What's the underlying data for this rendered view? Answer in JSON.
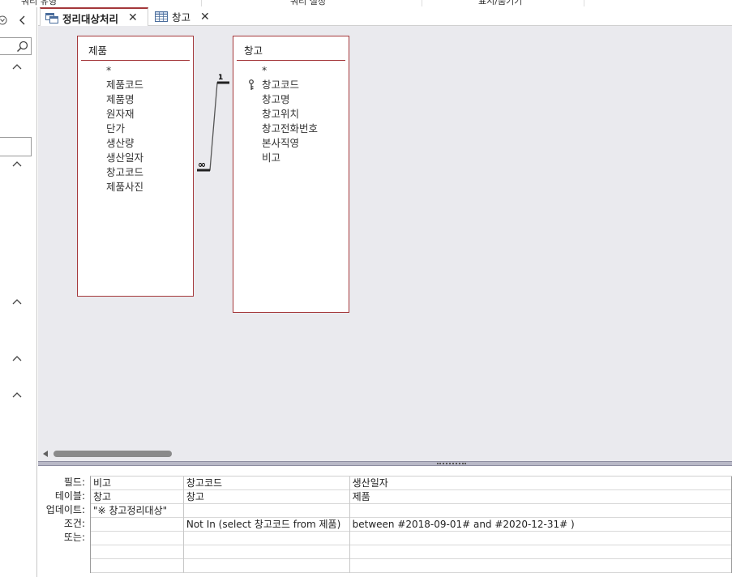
{
  "ribbon": {
    "items": [
      "쿼리 유형",
      "쿼리 설정",
      "표시/숨기기"
    ]
  },
  "tabs": [
    {
      "label": "정리대상처리",
      "icon": "query-icon",
      "active": true
    },
    {
      "label": "창고",
      "icon": "table-icon",
      "active": false
    }
  ],
  "tables": [
    {
      "name": "제품",
      "fields": [
        "*",
        "제품코드",
        "제품명",
        "원자재",
        "단가",
        "생산량",
        "생산일자",
        "창고코드",
        "제품사진"
      ]
    },
    {
      "name": "창고",
      "fields": [
        "*",
        "창고코드",
        "창고명",
        "창고위치",
        "창고전화번호",
        "본사직영",
        "비고"
      ],
      "primary_key": "창고코드"
    }
  ],
  "relationship": {
    "one_label": "1",
    "many_label": "∞"
  },
  "grid": {
    "row_labels": [
      "필드:",
      "테이블:",
      "업데이트:",
      "조건:",
      "또는:"
    ],
    "columns": [
      {
        "field": "비고",
        "table": "창고",
        "update": "\"※ 창고정리대상\"",
        "criteria": "",
        "or": ""
      },
      {
        "field": "창고코드",
        "table": "창고",
        "update": "",
        "criteria": "Not In (select 창고코드 from 제품)",
        "or": ""
      },
      {
        "field": "생산일자",
        "table": "제품",
        "update": "",
        "criteria": "between #2018-09-01# and #2020-12-31# )",
        "or": ""
      }
    ]
  },
  "colors": {
    "accent": "#a4373a",
    "design_bg": "#eaeaee"
  }
}
